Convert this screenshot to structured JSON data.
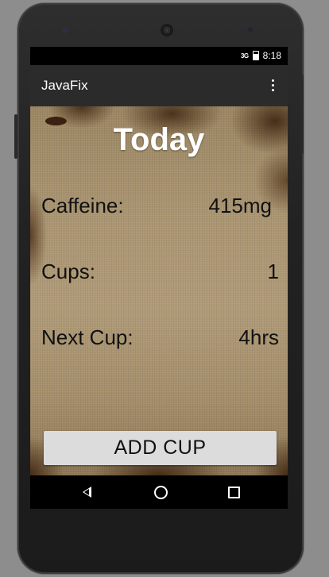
{
  "status_bar": {
    "signal": "3G",
    "time": "8:18"
  },
  "app_bar": {
    "title": "JavaFix",
    "overflow_icon": "more-vert-icon"
  },
  "main": {
    "heading": "Today",
    "stats": [
      {
        "label": "Caffeine:",
        "value": "415mg"
      },
      {
        "label": "Cups:",
        "value": "1"
      },
      {
        "label": "Next Cup:",
        "value": "4hrs"
      }
    ],
    "add_button_label": "ADD CUP"
  },
  "nav_bar": {
    "back_icon": "back-icon",
    "home_icon": "home-icon",
    "recents_icon": "recents-icon"
  },
  "colors": {
    "app_bar": "#2b2b2b",
    "button": "#dcdcdc",
    "title_text": "#ffffff",
    "stat_text": "#111111"
  }
}
